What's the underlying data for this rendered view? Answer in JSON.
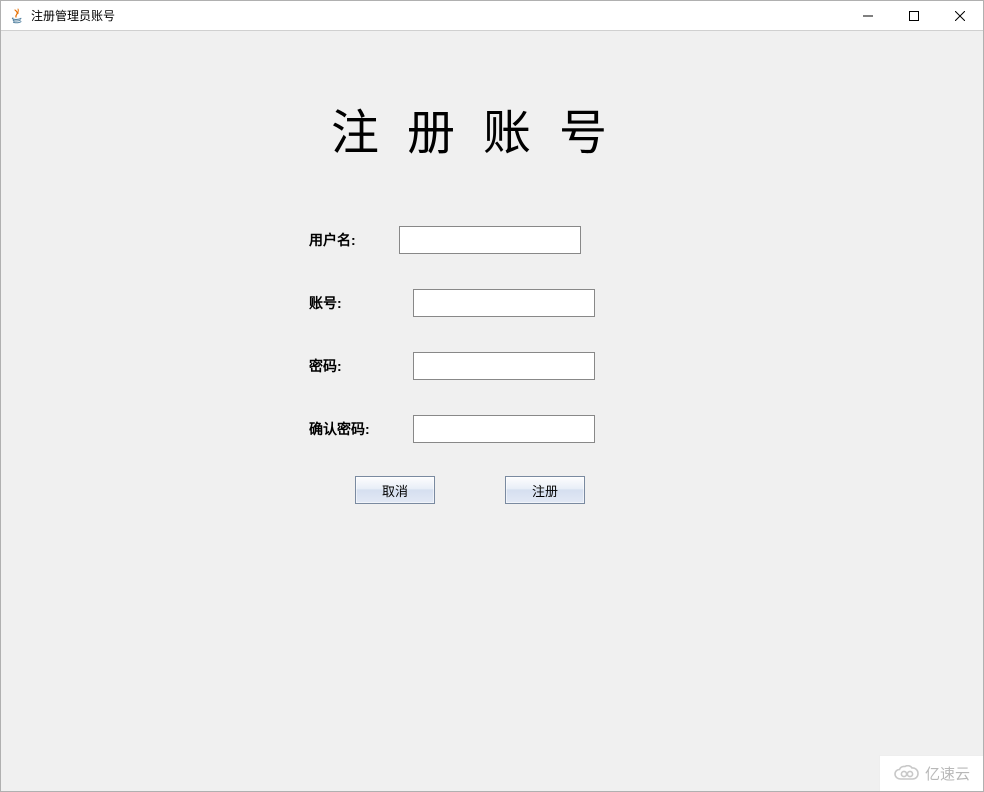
{
  "window": {
    "title": "注册管理员账号"
  },
  "heading": "注 册 账 号",
  "form": {
    "username": {
      "label": "用户名:",
      "value": ""
    },
    "account": {
      "label": "账号:",
      "value": ""
    },
    "password": {
      "label": "密码:",
      "value": ""
    },
    "confirm": {
      "label": "确认密码:",
      "value": ""
    }
  },
  "buttons": {
    "cancel": "取消",
    "register": "注册"
  },
  "watermark": {
    "text": "亿速云"
  }
}
